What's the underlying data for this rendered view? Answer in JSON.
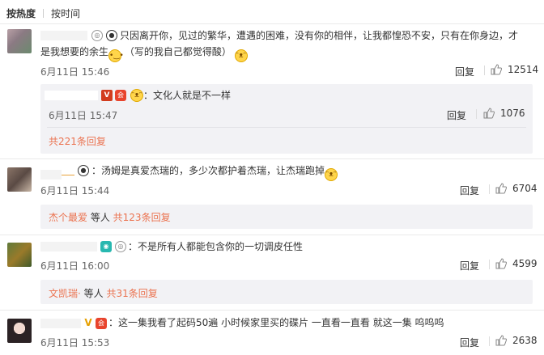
{
  "sort": {
    "hot_label": "按热度",
    "time_label": "按时间"
  },
  "comments": [
    {
      "text_line1": "只因离开你，见过的繁华，遭遇的困难，没有你的相伴，让我都惶恐不安，只有在你身边，才",
      "text_line2": "是我想要的余生",
      "text_suffix": "（写的我自己都觉得酸）",
      "time": "6月11日 15:46",
      "reply_label": "回复",
      "likes": "12514",
      "sub_reply": {
        "text": "：文化人就是不一样",
        "time": "6月11日 15:47",
        "reply_label": "回复",
        "likes": "1076"
      },
      "more_text": "共221条回复"
    },
    {
      "text": "：汤姆是真爱杰瑞的，多少次都护着杰瑞，让杰瑞跑掉",
      "time": "6月11日 15:44",
      "reply_label": "回复",
      "likes": "6704",
      "more_name": "杰个最爱",
      "more_mid": " 等人",
      "more_count": " 共123条回复"
    },
    {
      "text": "：不是所有人都能包含你的一切调皮任性",
      "time": "6月11日 16:00",
      "reply_label": "回复",
      "likes": "4599",
      "more_name": "文凯瑞·",
      "more_mid": " 等人",
      "more_count": " 共31条回复"
    },
    {
      "text": "：这一集我看了起码50遍 小时候家里买的碟片 一直看一直看 就这一集 呜呜呜",
      "time": "6月11日 15:53",
      "reply_label": "回复",
      "likes": "2638"
    }
  ],
  "icons": [
    "medal-icon",
    "panda-icon",
    "verified-v-icon",
    "emoji-icon",
    "like-icon",
    "camera-icon"
  ],
  "colors": {
    "link": "#eb7350",
    "reply_bg": "#f2f2f5",
    "text": "#333333",
    "muted": "#666666"
  }
}
